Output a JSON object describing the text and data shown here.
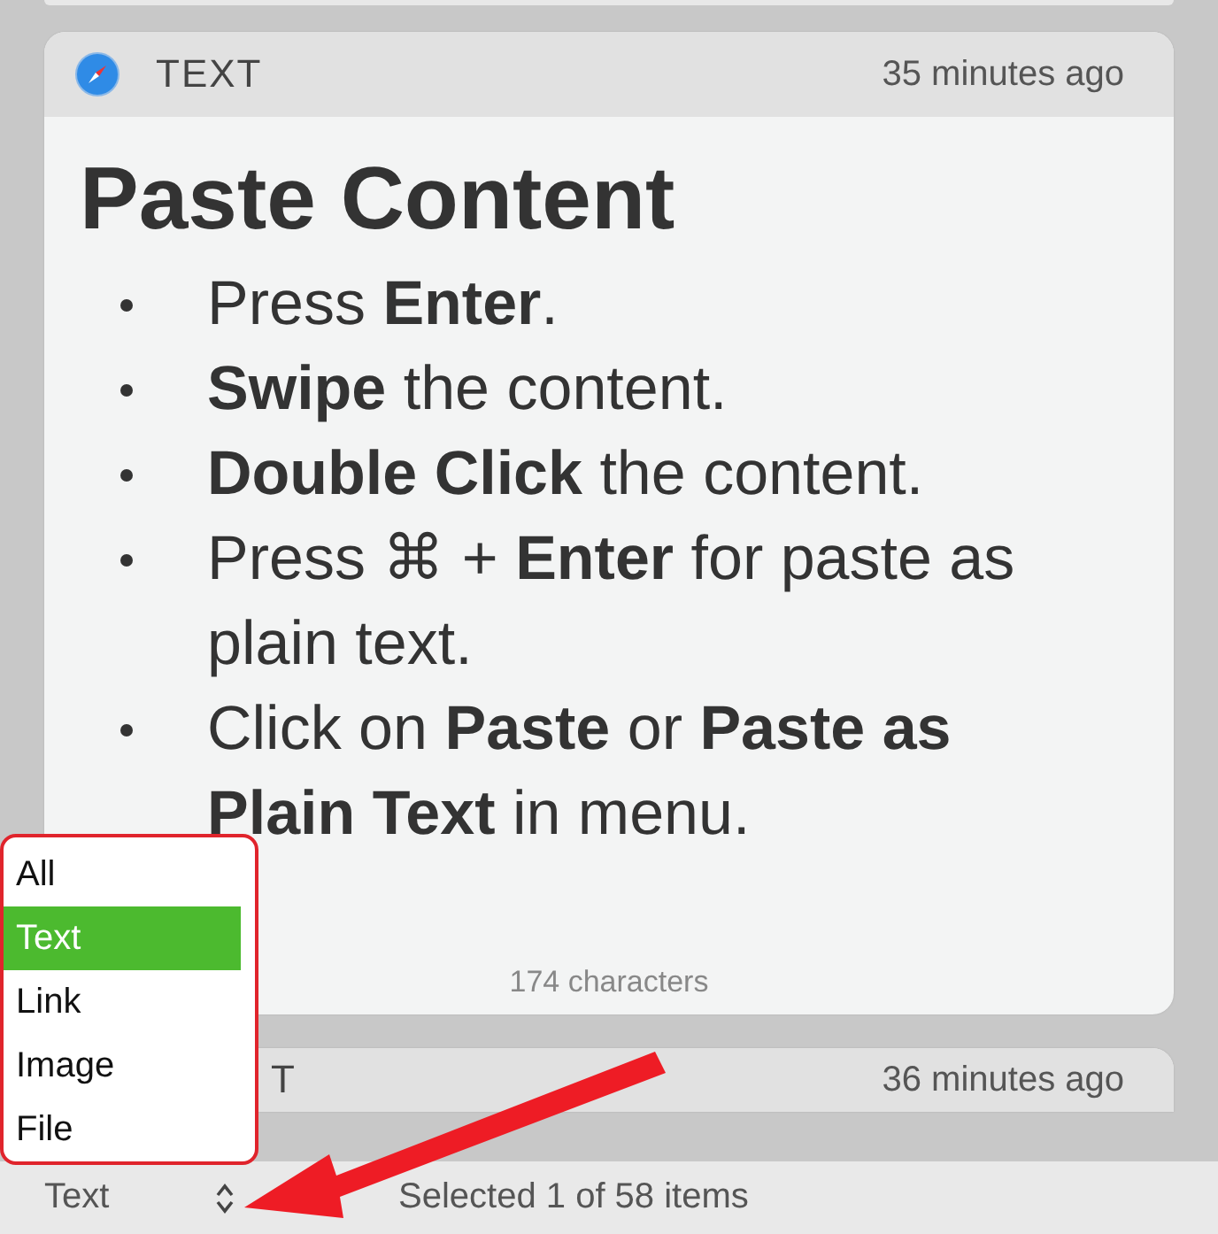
{
  "cards": [
    {
      "type_label": "TEXT",
      "time": "35 minutes ago",
      "heading": "Paste Content",
      "items": [
        "Press **Enter**.",
        "**Swipe** the content.",
        "**Double Click** the content.",
        "Press ⌘ + **Enter** for paste as plain text.",
        "Click on **Paste** or **Paste as Plain Text** in menu."
      ],
      "footer": "174 characters"
    },
    {
      "type_label": "T",
      "time": "36 minutes ago"
    }
  ],
  "filter_menu": {
    "options": [
      {
        "label": "All",
        "selected": false
      },
      {
        "label": "Text",
        "selected": true
      },
      {
        "label": "Link",
        "selected": false
      },
      {
        "label": "Image",
        "selected": false
      },
      {
        "label": "File",
        "selected": false
      }
    ]
  },
  "status_bar": {
    "filter_value": "Text",
    "selection": "Selected 1 of 58 items"
  }
}
